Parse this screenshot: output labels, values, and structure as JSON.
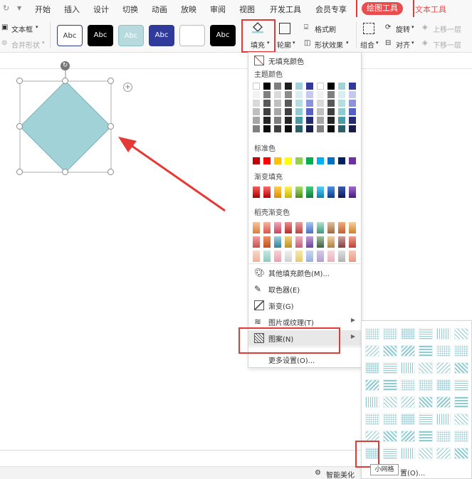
{
  "menubar": {
    "items": [
      "开始",
      "插入",
      "设计",
      "切换",
      "动画",
      "放映",
      "审阅",
      "视图",
      "开发工具",
      "会员专享"
    ],
    "drawing_tools": "绘图工具",
    "text_tools": "文本工具"
  },
  "ribbon": {
    "textbox": "文本框",
    "merge_shape": "合并形状",
    "style_abc": "Abc",
    "fill": "填充",
    "outline": "轮廓",
    "format_painter": "格式刷",
    "shape_effect": "形状效果",
    "group": "组合",
    "rotate": "旋转",
    "align": "对齐",
    "bring_forward": "上移一层",
    "send_backward": "下移一层"
  },
  "fill_menu": {
    "no_fill": "无填充颜色",
    "theme_colors": "主题颜色",
    "standard_colors": "标准色",
    "gradient_fill": "渐变填充",
    "shell_gradient": "稻壳渐变色",
    "more_fill_colors": "其他填充颜色(M)...",
    "eyedropper": "取色器(E)",
    "gradient": "渐变(G)",
    "picture_texture": "图片或纹理(T)",
    "pattern": "图案(N)",
    "more_settings": "更多设置(O)..."
  },
  "pattern_panel": {
    "tooltip": "小网格",
    "more_settings": "置(O)..."
  },
  "statusbar": {
    "smart_beautify": "智能美化"
  },
  "colors": {
    "accent_red": "#e94e4e",
    "shape_fill": "#a0d2d7"
  }
}
